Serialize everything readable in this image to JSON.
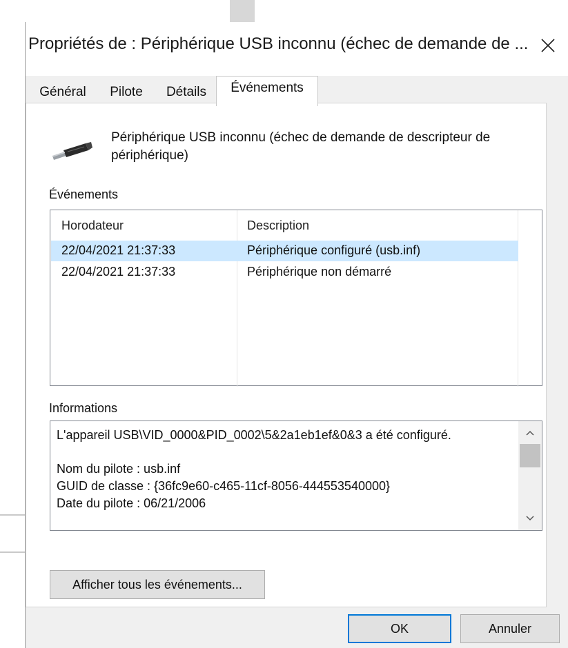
{
  "window": {
    "title": "Propriétés de : Périphérique USB inconnu (échec de demande de ..."
  },
  "tabs": [
    {
      "label": "Général"
    },
    {
      "label": "Pilote"
    },
    {
      "label": "Détails"
    },
    {
      "label": "Événements",
      "active": true
    }
  ],
  "device": {
    "icon": "usb-plug-icon",
    "name": "Périphérique USB inconnu (échec de demande de descripteur de périphérique)"
  },
  "events": {
    "section_label": "Événements",
    "columns": [
      "Horodateur",
      "Description"
    ],
    "rows": [
      {
        "timestamp": "22/04/2021 21:37:33",
        "description": "Périphérique configuré (usb.inf)",
        "selected": true
      },
      {
        "timestamp": "22/04/2021 21:37:33",
        "description": "Périphérique non démarré",
        "selected": false
      }
    ]
  },
  "info": {
    "section_label": "Informations",
    "lines": [
      "L'appareil USB\\VID_0000&PID_0002\\5&2a1eb1ef&0&3 a été configuré.",
      "",
      "Nom du pilote : usb.inf",
      "GUID de classe : {36fc9e60-c465-11cf-8056-444553540000}",
      "Date du pilote : 06/21/2006"
    ]
  },
  "buttons": {
    "show_all": "Afficher tous les événements...",
    "ok": "OK",
    "cancel": "Annuler"
  },
  "colors": {
    "selection": "#cce8ff",
    "default_button_border": "#0078d7"
  }
}
